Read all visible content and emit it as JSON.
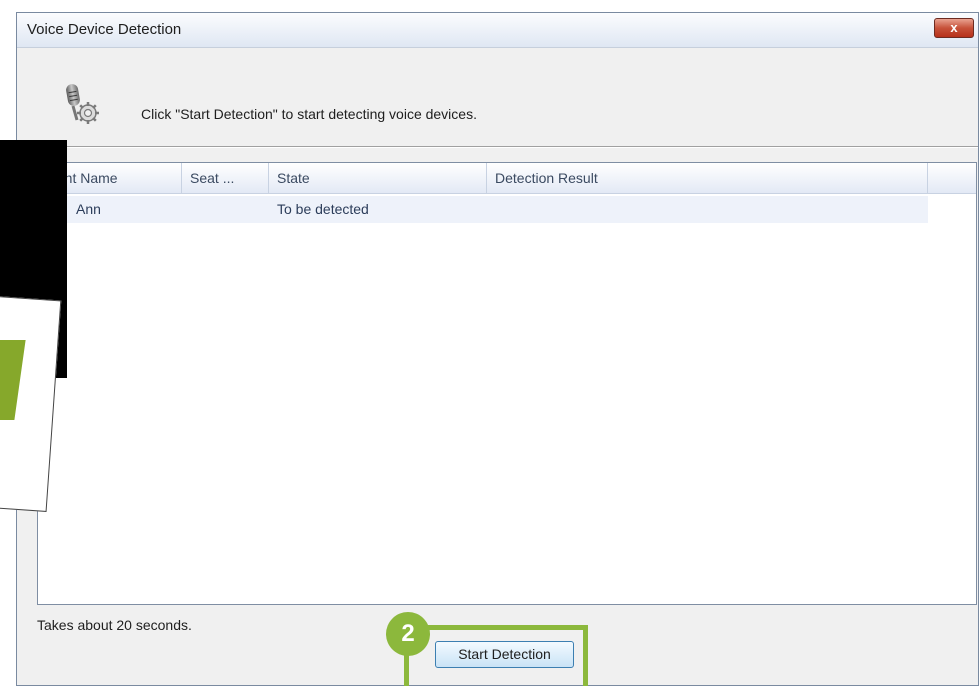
{
  "window": {
    "title": "Voice Device Detection",
    "close_label": "x"
  },
  "instruction": "Click \"Start Detection\" to start detecting voice devices.",
  "list": {
    "columns": [
      "ident Name",
      "Seat ...",
      "State",
      "Detection Result"
    ],
    "rows": [
      {
        "name": "Ann",
        "seat": "",
        "state": "To be detected",
        "result": ""
      }
    ]
  },
  "footer": {
    "hint": "Takes about 20 seconds.",
    "start_button": "Start Detection"
  },
  "annotation": {
    "step_badge": "2",
    "accent_color": "#8cb83c"
  }
}
